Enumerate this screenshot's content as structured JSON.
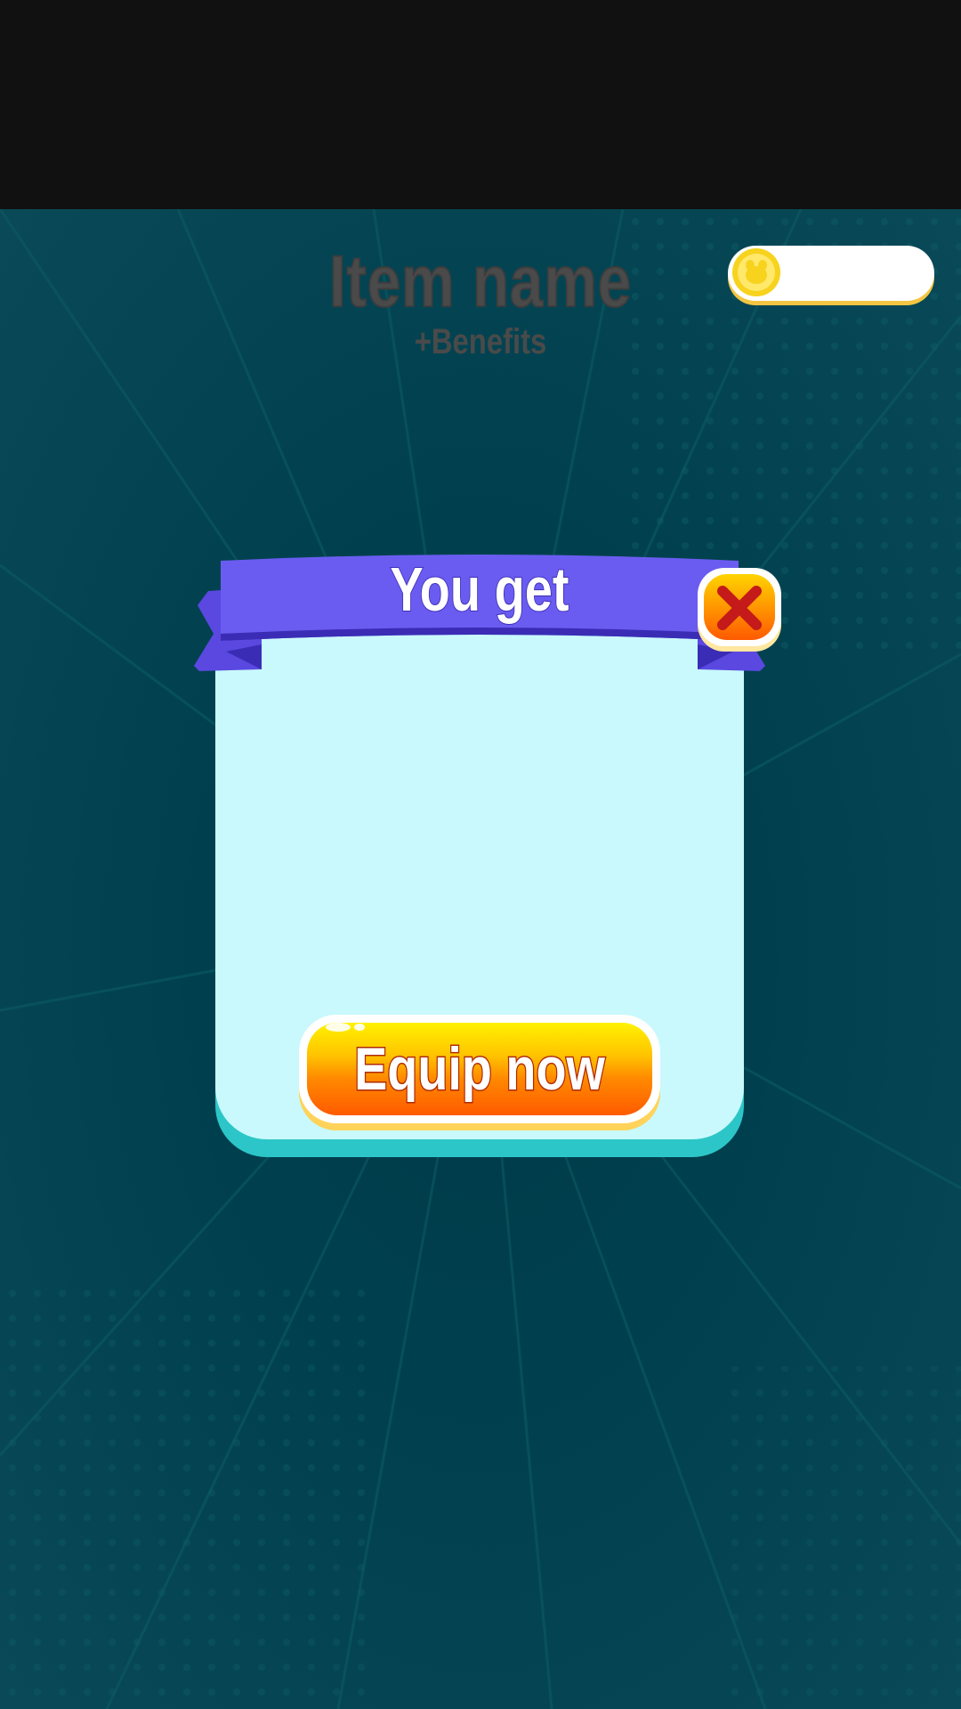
{
  "header": {
    "item_name": "Item name",
    "benefits": "+Benefits"
  },
  "currency": {
    "icon": "coin-icon",
    "amount": ""
  },
  "dialog": {
    "title": "You get",
    "close_icon": "close-icon",
    "equip_label": "Equip now"
  },
  "colors": {
    "background": "#00404e",
    "panel": "#c9f9fc",
    "ribbon": "#6a5cf0",
    "button_orange": "#ff6a00",
    "button_yellow": "#ffee00",
    "close_red": "#d0231b"
  }
}
